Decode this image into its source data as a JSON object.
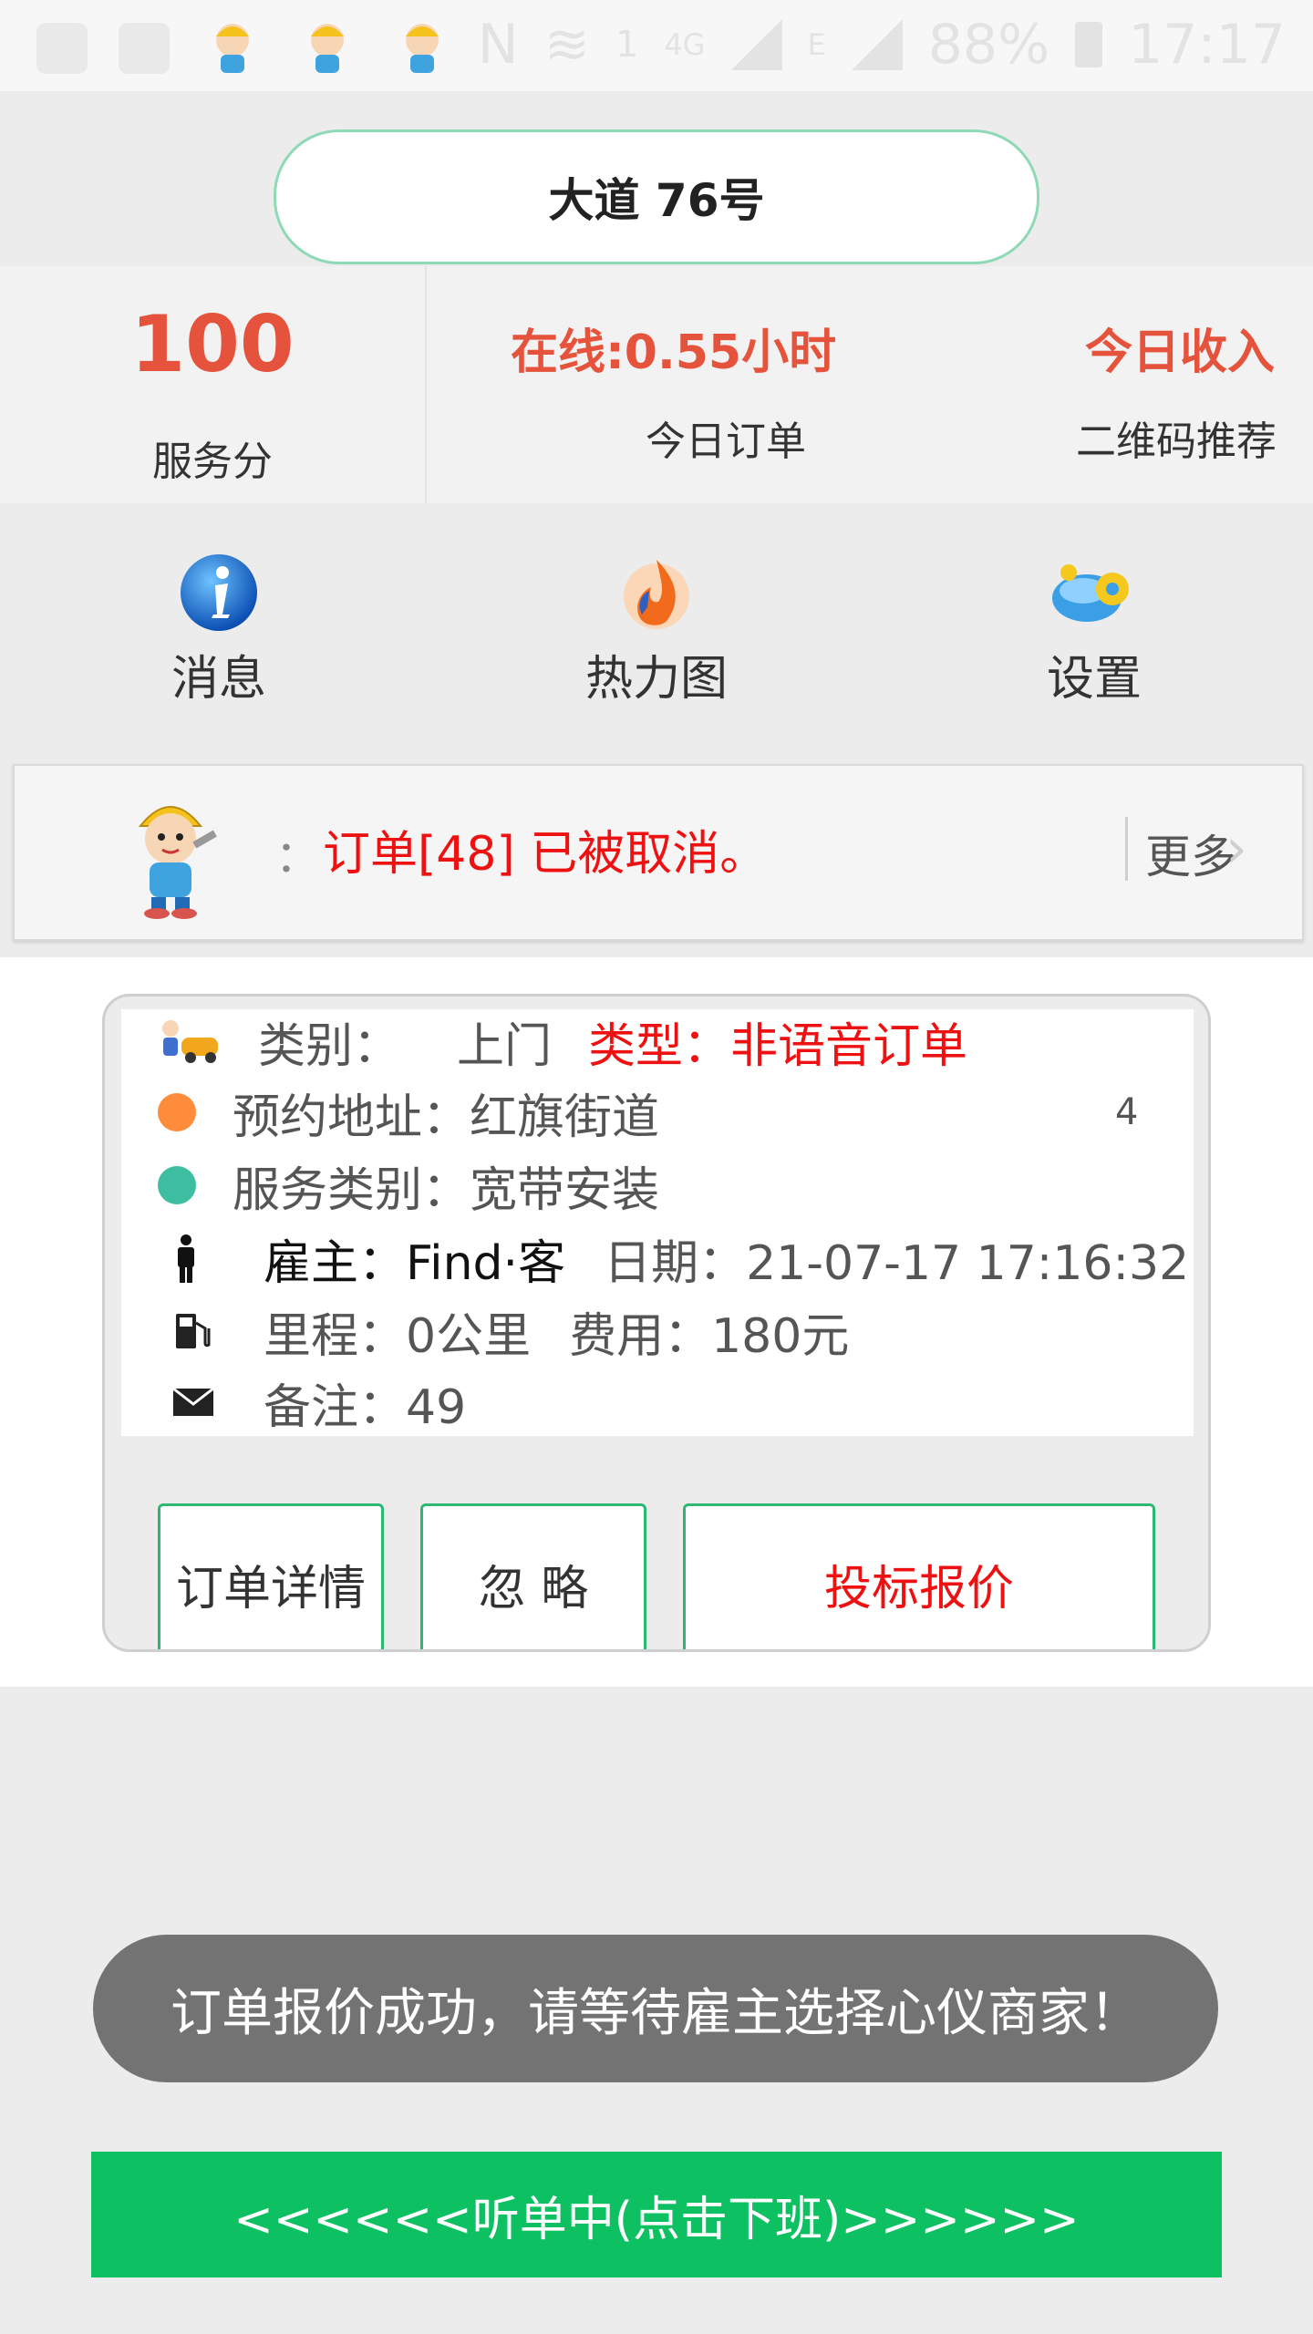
{
  "status_bar": {
    "battery": "88%",
    "time": "17:17",
    "network": "4G",
    "signal_label": "E",
    "sim_label": "1",
    "nfc_label": "N"
  },
  "header": {
    "title": "大道 76号"
  },
  "stats": {
    "score_value": "100",
    "score_label": "服务分",
    "online_label": "在线:0.55小时",
    "orders_label": "今日订单",
    "income_label": "今日收入",
    "qr_label": "二维码推荐"
  },
  "nav": {
    "messages": "消息",
    "heatmap": "热力图",
    "settings": "设置"
  },
  "notice": {
    "colon": "：",
    "text": "订单[48] 已被取消。",
    "more": "更多",
    "chevron": "›"
  },
  "order": {
    "category_prefix": "类别：",
    "category_value": "上门",
    "type_label": "类型：非语音订单",
    "address_label": "预约地址：红旗街道",
    "address_tail": "4",
    "service_label": "服务类别：宽带安装",
    "employer_label": "雇主：Find·客",
    "date_label": "日期：21-07-17 17:16:32",
    "mileage_label": "里程：0公里",
    "fee_label": "费用：180元",
    "note_label": "备注：49",
    "btn_detail": "订单详情",
    "btn_ignore": "忽 略",
    "btn_bid": "投标报价"
  },
  "toast": {
    "text": "订单报价成功，请等待雇主选择心仪商家！"
  },
  "bottom": {
    "button": "<<<<<<听单中(点击下班)>>>>>>"
  },
  "colors": {
    "accent_red": "#e5533c",
    "alert_red": "#ee1111",
    "green": "#0dc061",
    "border_green": "#2cb774"
  }
}
